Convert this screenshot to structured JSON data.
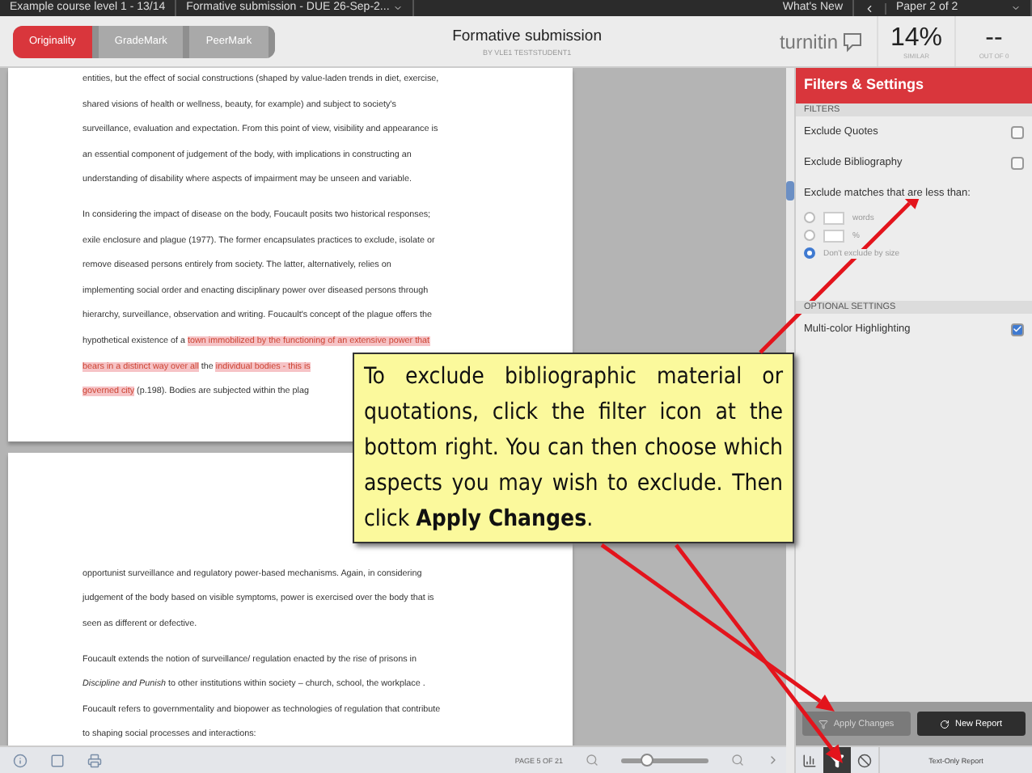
{
  "top_bar": {
    "course": "Example course level 1 - 13/14",
    "assignment": "Formative submission - DUE 26-Sep-2...",
    "whats_new": "What's New",
    "paper": "Paper 2 of 2"
  },
  "header": {
    "tabs": [
      {
        "label": "Originality",
        "selected": true
      },
      {
        "label": "GradeMark",
        "selected": false
      },
      {
        "label": "PeerMark",
        "selected": false
      }
    ],
    "title": "Formative submission",
    "author": "BY VLE1 TESTSTUDENT1",
    "logo": "turnitin",
    "similarity": "14%",
    "similarity_label": "SIMILAR",
    "grade": "--",
    "grade_label": "OUT OF 0"
  },
  "pages": [
    {
      "paragraphs": [
        {
          "lines": [
            "entities, but the effect of social constructions (shaped by value-laden trends in diet, exercise,",
            "shared visions of health or wellness, beauty, for example) and subject to society's",
            "surveillance, evaluation and expectation. From this point of view, visibility and appearance is",
            "an essential component of judgement of the body, with implications in constructing an",
            "understanding of disability where aspects of impairment may be unseen and variable."
          ]
        },
        {
          "lines": [
            "In considering the impact of disease on the body, Foucault posits two historical responses;",
            "exile enclosure and plague (1977). The former encapsulates practices to exclude, isolate or",
            "remove diseased persons entirely from society. The latter, alternatively, relies on",
            "implementing social order and enacting disciplinary power over diseased persons through",
            "hierarchy, surveillance, observation and writing. Foucault's concept of the plague offers the",
            [
              {
                "text": "hypothetical existence of a ",
                "highlighted": false
              },
              {
                "text": "town immobilized by the functioning of an extensive power that",
                "highlighted": true
              }
            ],
            [
              {
                "text": "bears in a distinct way over all",
                "highlighted": true
              },
              {
                "text": " the ",
                "highlighted": false
              },
              {
                "text": "individual bodies - this is",
                "highlighted": true
              }
            ],
            [
              {
                "text": "governed city",
                "highlighted": true
              },
              {
                "text": " (p.198). Bodies are subjected within the plag",
                "highlighted": false
              }
            ]
          ]
        }
      ]
    },
    {
      "paragraphs": [
        {
          "lines": [
            "opportunist surveillance and regulatory power-based mechanisms. Again, in considering",
            "judgement of the body based on visible symptoms, power is exercised over the body that is",
            "seen as different or defective."
          ]
        },
        {
          "lines": [
            "Foucault extends the notion of surveillance/ regulation enacted by the rise of prisons in",
            "*Discipline and Punish* to other institutions within society – church, school, the workplace .",
            "Foucault refers to governmentality and biopower as technologies of regulation that contribute",
            "to shaping social processes and interactions:"
          ]
        }
      ]
    }
  ],
  "sidebar": {
    "title": "Filters & Settings",
    "sections": [
      {
        "heading": "FILTERS",
        "items": [
          {
            "kind": "checkbox",
            "label": "Exclude Quotes",
            "checked": false
          },
          {
            "kind": "checkbox",
            "label": "Exclude Bibliography",
            "checked": false
          },
          {
            "kind": "size",
            "label": "Exclude matches that are less than:",
            "options": [
              {
                "kind": "input",
                "label": "words",
                "selected": false
              },
              {
                "kind": "input",
                "label": "%",
                "selected": false
              },
              {
                "kind": "text",
                "label": "Don't exclude by size",
                "selected": true
              }
            ]
          }
        ]
      },
      {
        "heading": "OPTIONAL SETTINGS",
        "items": [
          {
            "kind": "checkbox",
            "label": "Multi-color Highlighting",
            "checked": true
          }
        ]
      }
    ],
    "buttons": [
      {
        "kind": "filter",
        "label": "Apply Changes",
        "disabled": true
      },
      {
        "kind": "refresh",
        "label": "New Report",
        "disabled": false
      }
    ],
    "tools": [
      {
        "kind": "chart",
        "selected": false
      },
      {
        "kind": "filter",
        "selected": true
      },
      {
        "kind": "block",
        "selected": false
      }
    ],
    "text_only": "Text-Only Report"
  },
  "bottom_bar": {
    "page": "PAGE 5 OF 21",
    "zoom": {
      "level": 0.3
    }
  },
  "callout": {
    "text": "To exclude bibliographic material or quotations, click the filter icon at the bottom right. You can then choose which aspects you may wish to exclude. Then click **Apply Changes**."
  }
}
